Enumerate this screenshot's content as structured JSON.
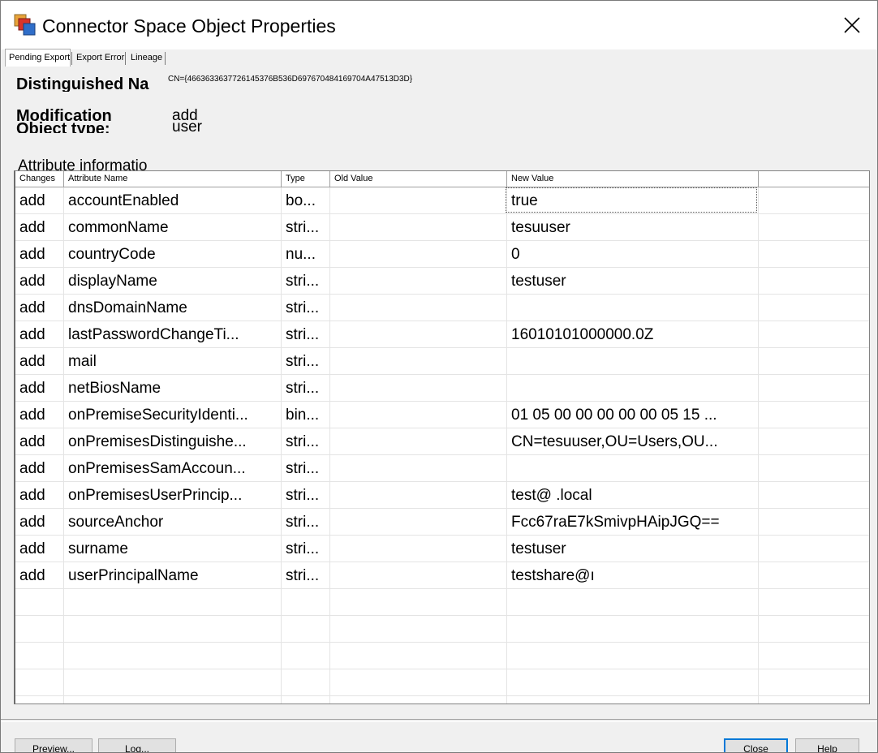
{
  "window": {
    "title": "Connector Space Object Properties"
  },
  "tabs": [
    {
      "label": "Pending Export",
      "active": true
    },
    {
      "label": "Export Error",
      "active": false
    },
    {
      "label": "Lineage",
      "active": false
    }
  ],
  "fields": {
    "dn_label": "Distinguished Na",
    "dn_value": "CN={4663633637726145376B536D697670484169704A47513D3D}",
    "modification_label": "Modification",
    "modification_value": "add",
    "object_type_label": "Object type:",
    "object_type_value": "user",
    "attribute_info_label": "Attribute informatio"
  },
  "grid": {
    "columns": [
      "Changes",
      "Attribute Name",
      "Type",
      "Old Value",
      "New Value"
    ],
    "rows": [
      {
        "change": "add",
        "name": "accountEnabled",
        "type": "bo...",
        "old": "",
        "new": "true"
      },
      {
        "change": "add",
        "name": "commonName",
        "type": "stri...",
        "old": "",
        "new": "tesuuser"
      },
      {
        "change": "add",
        "name": "countryCode",
        "type": "nu...",
        "old": "",
        "new": "0"
      },
      {
        "change": "add",
        "name": "displayName",
        "type": "stri...",
        "old": "",
        "new": "testuser"
      },
      {
        "change": "add",
        "name": "dnsDomainName",
        "type": "stri...",
        "old": "",
        "new": ""
      },
      {
        "change": "add",
        "name": "lastPasswordChangeTi...",
        "type": "stri...",
        "old": "",
        "new": "16010101000000.0Z"
      },
      {
        "change": "add",
        "name": "mail",
        "type": "stri...",
        "old": "",
        "new": ""
      },
      {
        "change": "add",
        "name": "netBiosName",
        "type": "stri...",
        "old": "",
        "new": ""
      },
      {
        "change": "add",
        "name": "onPremiseSecurityIdenti...",
        "type": "bin...",
        "old": "",
        "new": "01 05 00 00 00 00 00 05 15 ..."
      },
      {
        "change": "add",
        "name": "onPremisesDistinguishe...",
        "type": "stri...",
        "old": "",
        "new": "CN=tesuuser,OU=Users,OU..."
      },
      {
        "change": "add",
        "name": "onPremisesSamAccoun...",
        "type": "stri...",
        "old": "",
        "new": ""
      },
      {
        "change": "add",
        "name": "onPremisesUserPrincip...",
        "type": "stri...",
        "old": "",
        "new": "test@            .local"
      },
      {
        "change": "add",
        "name": "sourceAnchor",
        "type": "stri...",
        "old": "",
        "new": "Fcc67raE7kSmivpHAipJGQ=="
      },
      {
        "change": "add",
        "name": "surname",
        "type": "stri...",
        "old": "",
        "new": "testuser"
      },
      {
        "change": "add",
        "name": "userPrincipalName",
        "type": "stri...",
        "old": "",
        "new": "testshare@ı"
      }
    ]
  },
  "buttons": {
    "preview": "Preview...",
    "log": "Log...",
    "close": "Close",
    "help": "Help"
  }
}
